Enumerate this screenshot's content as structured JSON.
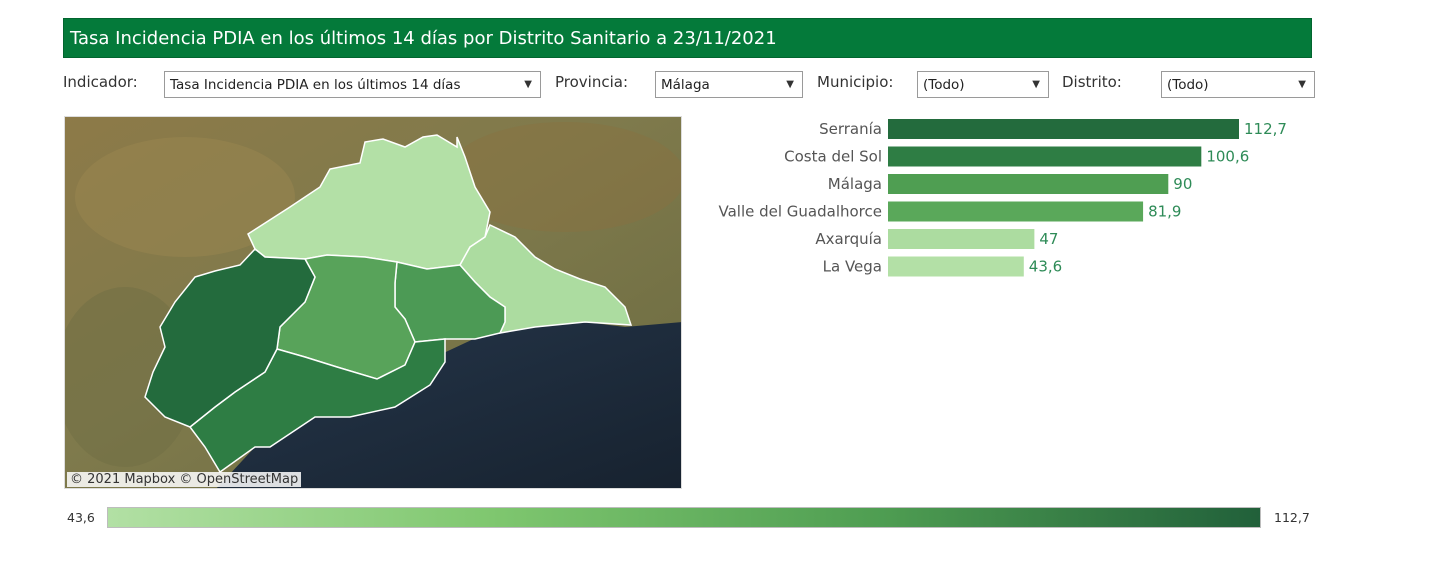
{
  "header": {
    "title": "Tasa Incidencia PDIA en los últimos 14 días por Distrito Sanitario a 23/11/2021"
  },
  "filters": {
    "indicador_label": "Indicador:",
    "indicador_value": "Tasa Incidencia PDIA en los últimos 14 días",
    "provincia_label": "Provincia:",
    "provincia_value": "Málaga",
    "municipio_label": "Municipio:",
    "municipio_value": "(Todo)",
    "distrito_label": "Distrito:",
    "distrito_value": "(Todo)",
    "arrow_icon": "dropdown-arrow-icon"
  },
  "map": {
    "attribution": "© 2021 Mapbox  © OpenStreetMap",
    "colors": {
      "land": "#8a7a4e",
      "sea": "#1e2d3f",
      "border": "#ffffff"
    }
  },
  "chart_data": {
    "type": "bar",
    "orientation": "horizontal",
    "categories": [
      "Serranía",
      "Costa del Sol",
      "Málaga",
      "Valle del Guadalhorce",
      "Axarquía",
      "La Vega"
    ],
    "values": [
      112.7,
      100.6,
      90,
      81.9,
      47,
      43.6
    ],
    "value_labels": [
      "112,7",
      "100,6",
      "90",
      "81,9",
      "47",
      "43,6"
    ],
    "colors": [
      "#236b3d",
      "#2e7d44",
      "#4f9e52",
      "#5aa85a",
      "#acdca0",
      "#b3e0a6"
    ],
    "label_color": "#2e8b57",
    "xlim": [
      0,
      112.7
    ]
  },
  "legend": {
    "min_label": "43,6",
    "max_label": "112,7",
    "gradient": [
      "#b2e0a4",
      "#7fc76f",
      "#4f9e52",
      "#21603a"
    ]
  }
}
